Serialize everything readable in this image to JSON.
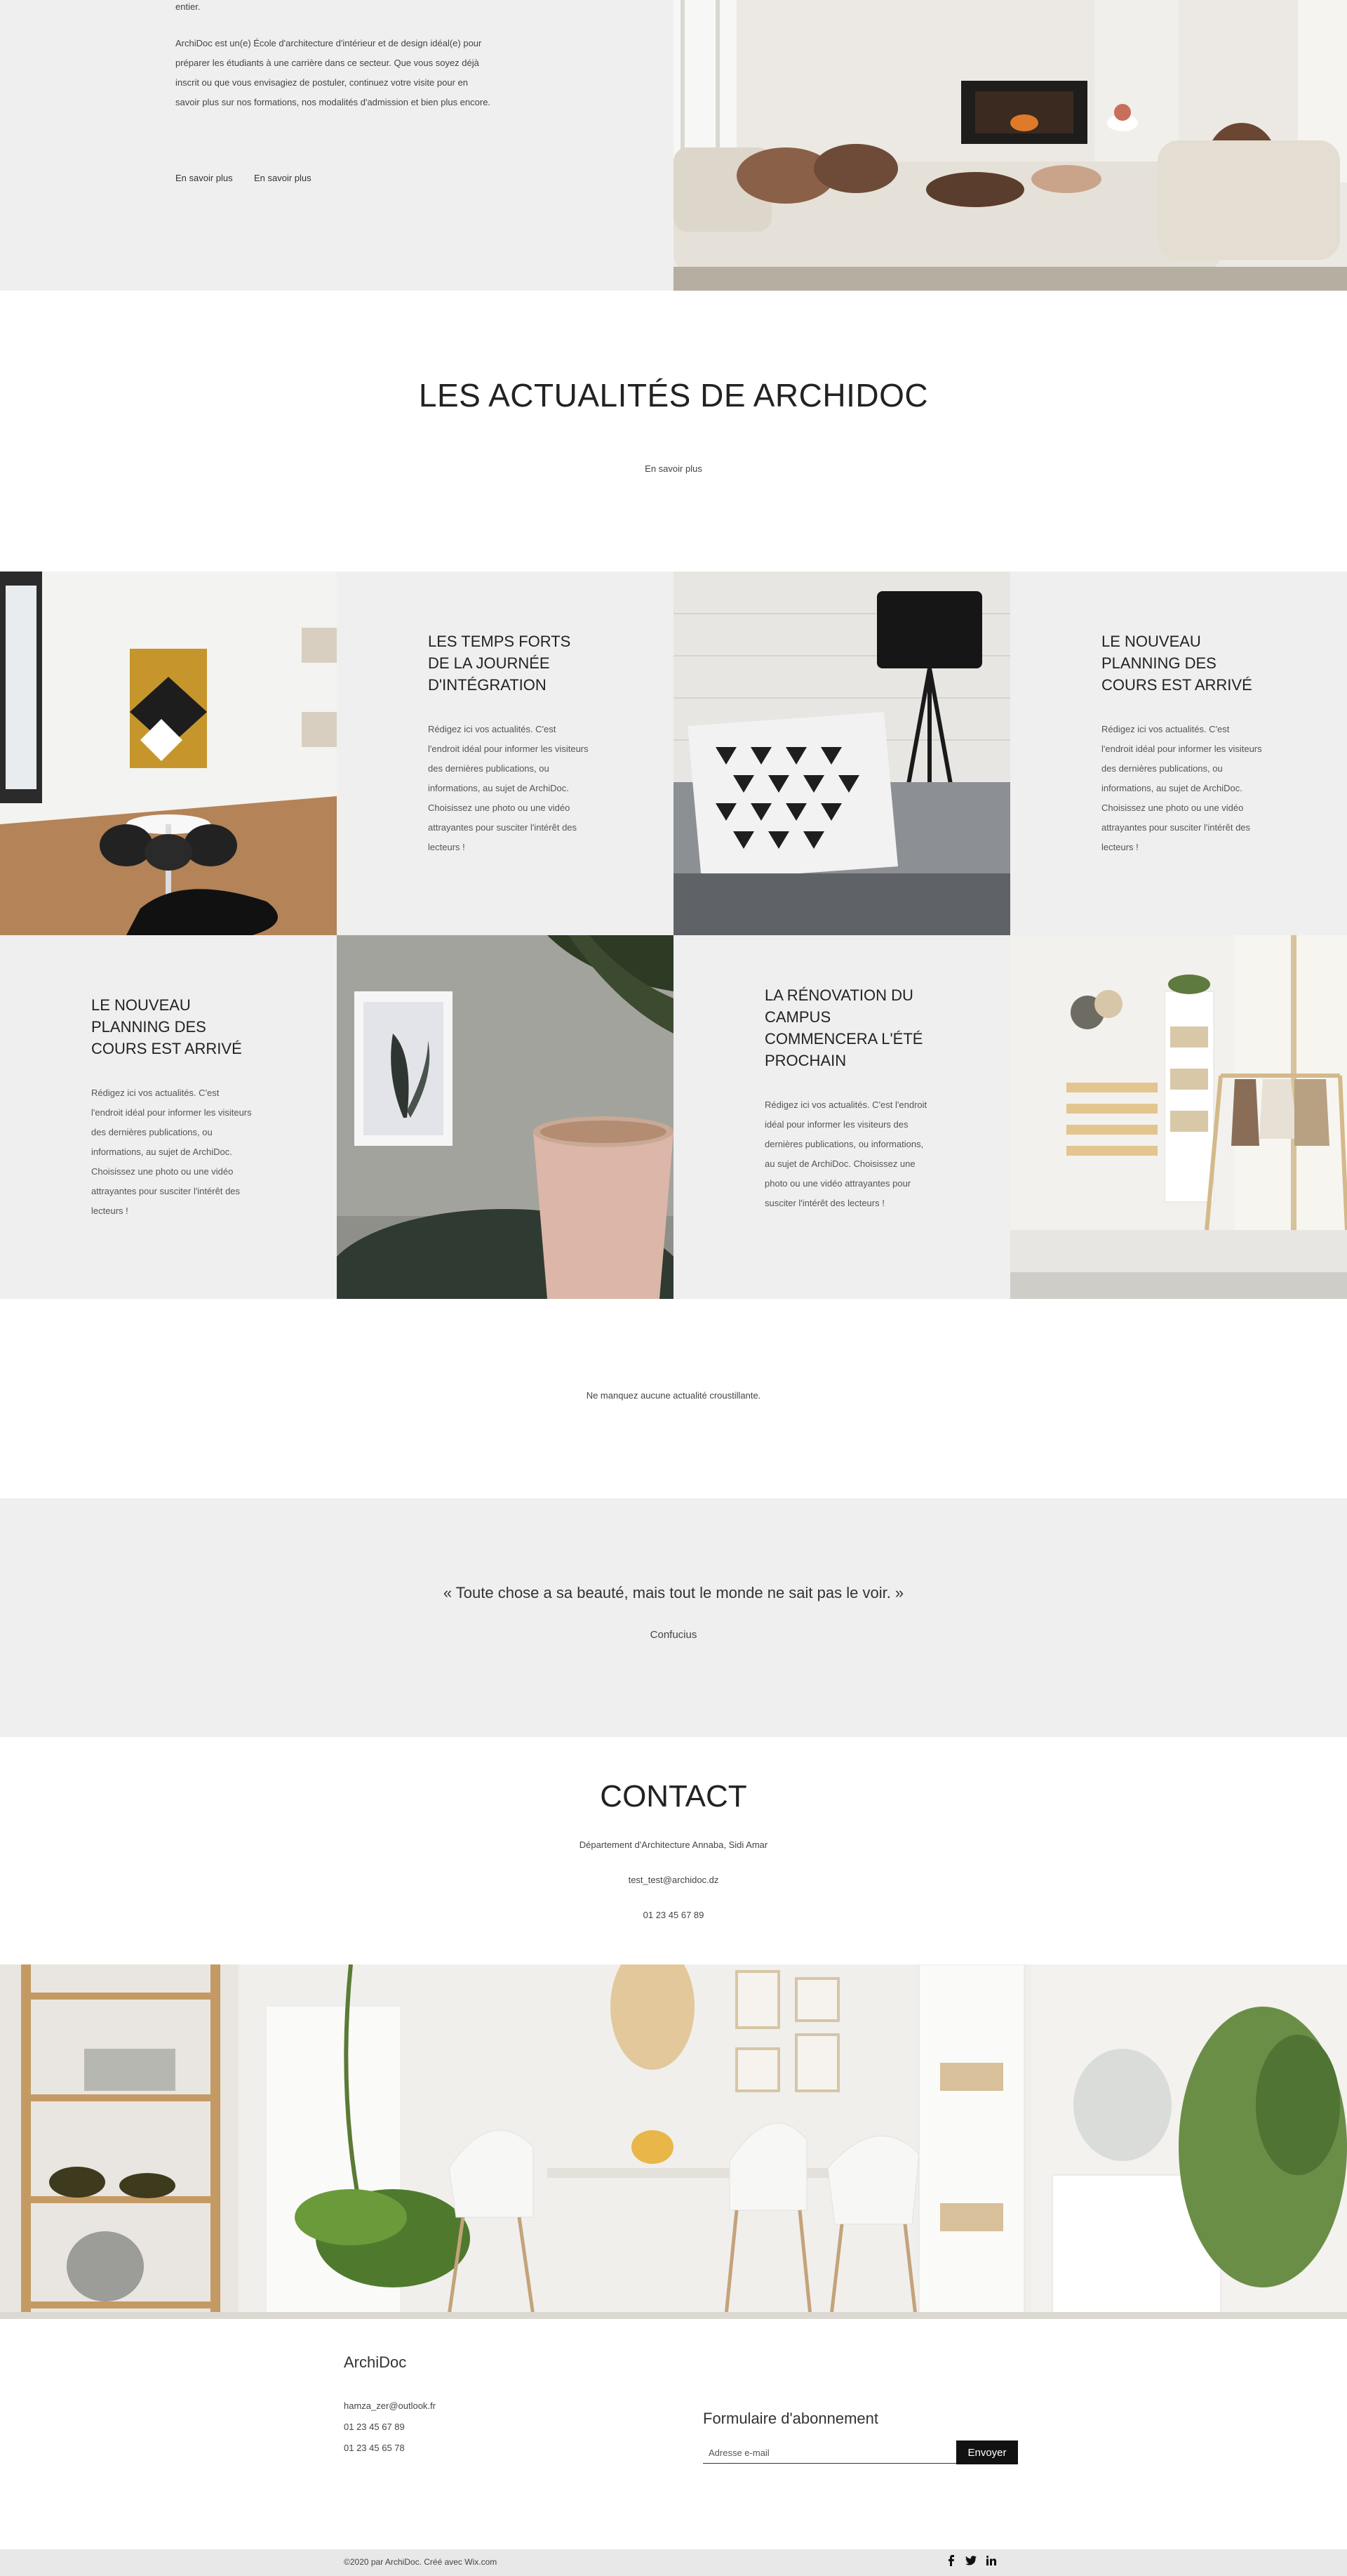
{
  "intro": {
    "partial_word": "entier.",
    "paragraph": "ArchiDoc est un(e) École d'architecture d'intérieur et de design idéal(e) pour préparer les étudiants à une carrière dans ce secteur. Que vous soyez déjà inscrit ou que vous envisagiez de postuler, continuez votre visite pour en savoir plus sur nos formations, nos modalités d'admission et bien plus encore.",
    "link1": "En savoir plus",
    "link2": "En savoir plus"
  },
  "news": {
    "title": "LES ACTUALITÉS DE ARCHIDOC",
    "more": "En savoir plus",
    "cards": [
      {
        "title": "LES TEMPS FORTS DE LA JOURNÉE D'INTÉGRATION",
        "body": "Rédigez ici vos actualités. C'est l'endroit idéal pour informer les visiteurs des dernières publications, ou informations, au sujet de ArchiDoc. Choisissez une photo ou une vidéo attrayantes pour susciter l'intérêt des lecteurs !"
      },
      {
        "title": "LE NOUVEAU PLANNING DES COURS EST ARRIVÉ",
        "body": "Rédigez ici vos actualités. C'est l'endroit idéal pour informer les visiteurs des dernières publications, ou informations, au sujet de ArchiDoc. Choisissez une photo ou une vidéo attrayantes pour susciter l'intérêt des lecteurs !"
      },
      {
        "title": "LE NOUVEAU PLANNING DES COURS EST ARRIVÉ",
        "body": "Rédigez ici vos actualités. C'est l'endroit idéal pour informer les visiteurs des dernières publications, ou informations, au sujet de ArchiDoc. Choisissez une photo ou une vidéo attrayantes pour susciter l'intérêt des lecteurs !"
      },
      {
        "title": "LA RÉNOVATION DU CAMPUS COMMENCERA L'ÉTÉ PROCHAIN",
        "body": "Rédigez ici vos actualités. C'est l'endroit idéal pour informer les visiteurs des dernières publications, ou informations, au sujet de ArchiDoc. Choisissez une photo ou une vidéo attrayantes pour susciter l'intérêt des lecteurs !"
      }
    ],
    "tagline": "Ne manquez aucune actualité croustillante."
  },
  "quote": {
    "text": "« Toute chose a sa beauté, mais tout le monde ne sait pas le voir. »",
    "author": "Confucius"
  },
  "contact": {
    "title": "CONTACT",
    "address": "Département d'Architecture Annaba, Sidi Amar",
    "email": "test_test@archidoc.dz",
    "phone": "01 23 45 67 89"
  },
  "footer": {
    "brand": "ArchiDoc",
    "email": "hamza_zer@outlook.fr",
    "phone1": "01 23 45 67 89",
    "phone2": "01 23 45 65 78",
    "subscribe_title": "Formulaire d'abonnement",
    "email_placeholder": "Adresse e-mail",
    "send_label": "Envoyer",
    "copyright": "©2020 par ArchiDoc. Créé avec Wix.com",
    "social_icons": [
      "facebook-icon",
      "twitter-icon",
      "linkedin-icon"
    ]
  },
  "colors": {
    "section_gray": "#efefef",
    "text_dark": "#222222",
    "button_black": "#111111"
  }
}
